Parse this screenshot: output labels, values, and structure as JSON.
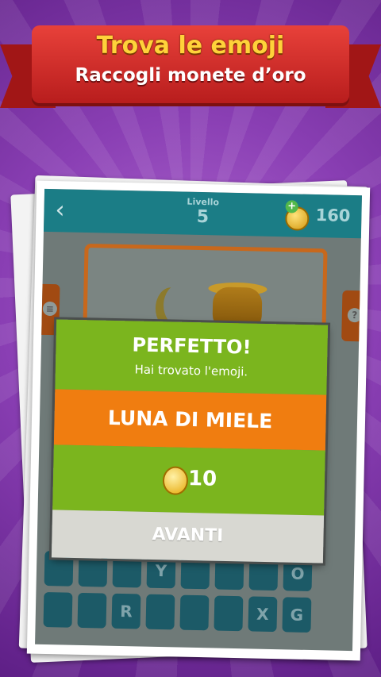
{
  "banner": {
    "line1": "Trova le emoji",
    "line2": "Raccogli monete d’oro"
  },
  "header": {
    "level_label": "Livello",
    "level_number": "5",
    "coins": "160",
    "back_icon": "back-arrow-icon"
  },
  "side_buttons": {
    "left_icon": "coin-stack-icon",
    "right_icon": "question-icon",
    "right_symbol": "?"
  },
  "modal": {
    "title": "PERFETTO!",
    "subtitle": "Hai trovato l'emoji.",
    "answer": "LUNA DI MIELE",
    "reward": "10",
    "next_button": "AVANTI"
  },
  "keyboard": {
    "row1": [
      "",
      "",
      "",
      "Y",
      "",
      "",
      "",
      "O"
    ],
    "row2": [
      "",
      "",
      "R",
      "",
      "",
      "",
      "X",
      "G"
    ]
  },
  "colors": {
    "topbar": "#1b7d86",
    "green": "#7bb51e",
    "orange": "#f07d10",
    "banner_red": "#c62a24"
  }
}
